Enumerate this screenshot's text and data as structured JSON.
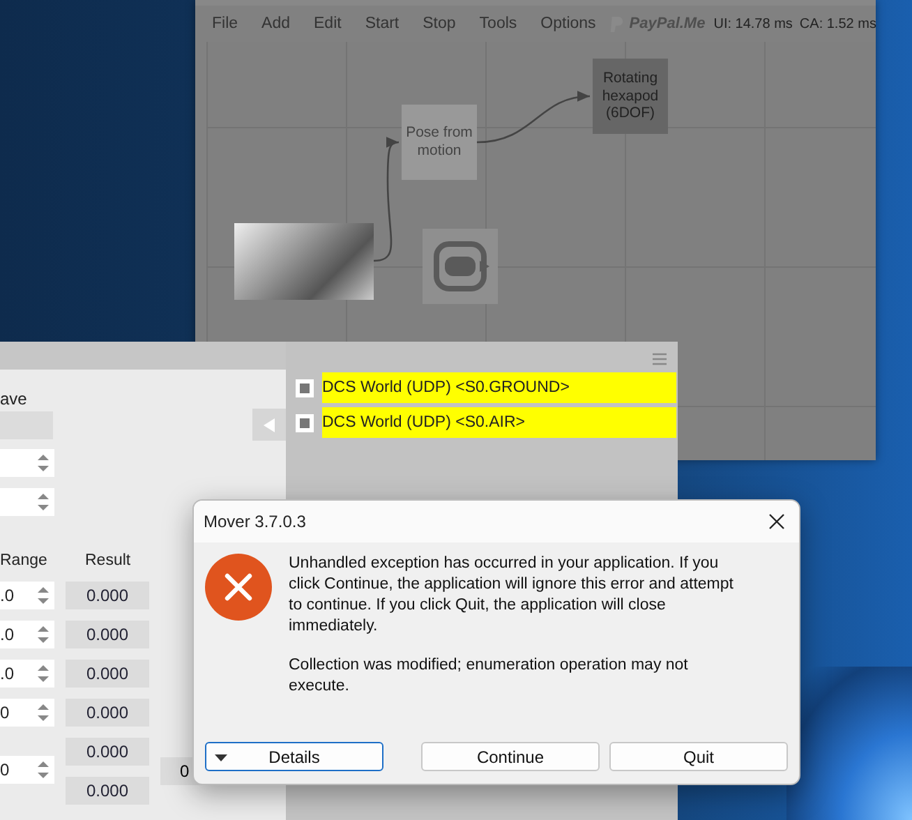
{
  "app_window": {
    "menu": [
      "File",
      "Add",
      "Edit",
      "Start",
      "Stop",
      "Tools",
      "Options"
    ],
    "donate_logo": "PayPal.Me",
    "stats": [
      "UI: 14.78 ms",
      "CA: 1.52 ms"
    ],
    "nodes": [
      {
        "kind": "image"
      },
      {
        "kind": "filter",
        "label": "Pose from motion"
      },
      {
        "kind": "output",
        "label": "Rotating hexapod (6DOF)"
      },
      {
        "kind": "vr"
      }
    ]
  },
  "panel": {
    "heading": "ave",
    "columns": [
      "Range",
      "Result"
    ],
    "range_spinners": [
      ".0",
      ".0",
      ".0",
      "0",
      "0"
    ],
    "results": [
      "0.000",
      "0.000",
      "0.000",
      "0.000",
      "0.000",
      "0.000"
    ],
    "extra_field": "0"
  },
  "sources": [
    {
      "label": "DCS World (UDP) <S0.GROUND>",
      "checked": true
    },
    {
      "label": "DCS World (UDP) <S0.AIR>",
      "checked": true
    }
  ],
  "dialog": {
    "title": "Mover 3.7.0.3",
    "message": "Unhandled exception has occurred in your application. If you click Continue, the application will ignore this error and attempt to continue. If you click Quit, the application will close immediately.",
    "detail": "Collection was modified; enumeration operation may not execute.",
    "buttons": [
      {
        "label": "Details",
        "kind": "expander",
        "selected": true
      },
      {
        "label": "Continue",
        "kind": "plain",
        "selected": false
      },
      {
        "label": "Quit",
        "kind": "plain",
        "selected": false
      }
    ]
  }
}
